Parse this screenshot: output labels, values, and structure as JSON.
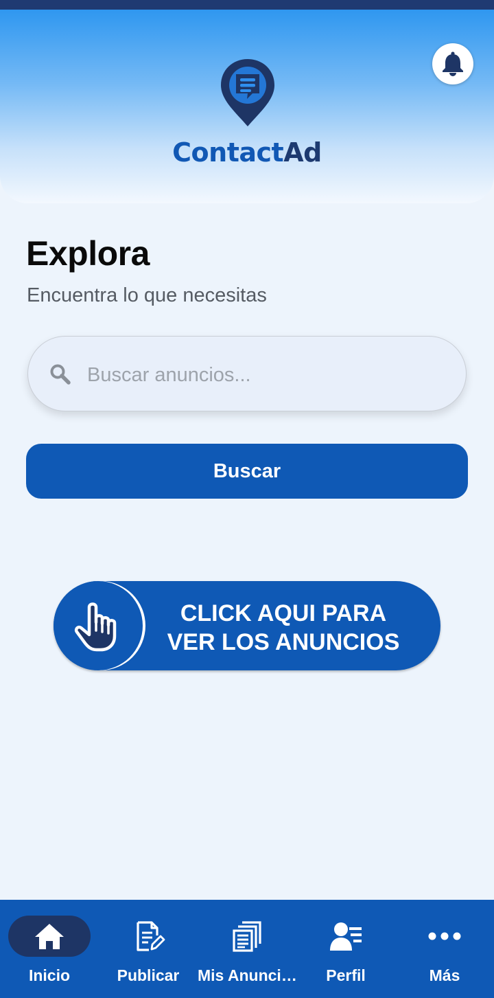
{
  "header": {
    "logo_part1": "Contact",
    "logo_part2": "Ad",
    "notification_icon": "bell-icon"
  },
  "explore": {
    "title": "Explora",
    "subtitle": "Encuentra lo que necesitas"
  },
  "search": {
    "placeholder": "Buscar anuncios...",
    "value": "",
    "button_label": "Buscar"
  },
  "cta": {
    "line1": "CLICK AQUI PARA",
    "line2": "VER LOS ANUNCIOS",
    "icon": "pointing-hand-icon"
  },
  "nav": {
    "active": "Inicio",
    "items": [
      {
        "label": "Inicio",
        "icon": "home-icon"
      },
      {
        "label": "Publicar",
        "icon": "edit-document-icon"
      },
      {
        "label": "Mis Anunci…",
        "icon": "documents-icon"
      },
      {
        "label": "Perfil",
        "icon": "user-list-icon"
      },
      {
        "label": "Más",
        "icon": "more-dots-icon"
      }
    ]
  },
  "colors": {
    "primary": "#0f59b5",
    "dark_navy": "#1e3565",
    "background": "#edf4fc"
  }
}
